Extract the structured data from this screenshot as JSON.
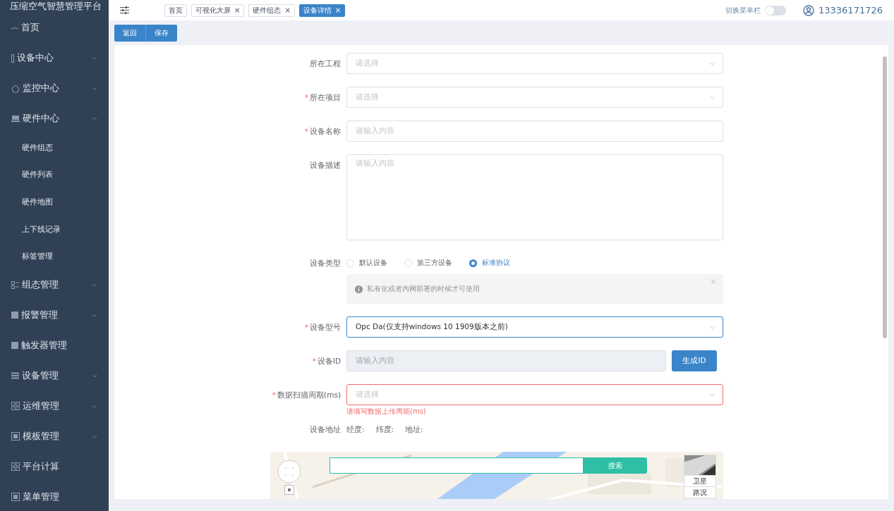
{
  "sidebar": {
    "title": "压缩空气智慧管理平台",
    "items": [
      {
        "label": "首页"
      },
      {
        "label": "设备中心",
        "expanded": false
      },
      {
        "label": "监控中心",
        "expanded": false
      },
      {
        "label": "硬件中心",
        "expanded": true,
        "children": [
          {
            "label": "硬件组态"
          },
          {
            "label": "硬件列表"
          },
          {
            "label": "硬件地图"
          },
          {
            "label": "上下线记录"
          },
          {
            "label": "标签管理"
          }
        ]
      },
      {
        "label": "组态管理",
        "expanded": false
      },
      {
        "label": "报警管理",
        "expanded": false
      },
      {
        "label": "触发器管理"
      },
      {
        "label": "设备管理",
        "expanded": false
      },
      {
        "label": "运维管理",
        "expanded": false
      },
      {
        "label": "模板管理",
        "expanded": false
      },
      {
        "label": "平台计算"
      },
      {
        "label": "菜单管理"
      }
    ]
  },
  "tabs": [
    {
      "label": "首页",
      "selected": false
    },
    {
      "label": "可视化大屏",
      "close": "×",
      "selected": false
    },
    {
      "label": "硬件组态",
      "close": "×",
      "selected": false
    },
    {
      "label": "设备详情",
      "close": "×",
      "selected": true
    }
  ],
  "menu_toggle": {
    "label": "切换菜单栏",
    "on": false
  },
  "user": "13336171726",
  "buttons": [
    "返回",
    "保存"
  ],
  "form": [
    {
      "kind": "select",
      "label": "所在工程",
      "placeholder": "请选择"
    },
    {
      "kind": "select",
      "label": "所在项目",
      "mark": "*",
      "placeholder": "请选择"
    },
    {
      "kind": "input",
      "label": "设备名称",
      "mark": "*",
      "placeholder": "请输入内容"
    },
    {
      "kind": "textarea",
      "label": "设备描述",
      "placeholder": "请输入内容"
    },
    {
      "kind": "radio",
      "label": "设备类型",
      "options": [
        {
          "label": "默认设备",
          "selected": false
        },
        {
          "label": "第三方设备",
          "selected": false
        },
        {
          "label": "标准协议",
          "selected": true
        }
      ]
    },
    {
      "kind": "alert",
      "text": "私有化或者内网部署的时候才可使用",
      "close": "×"
    },
    {
      "kind": "select",
      "label": "设备型号",
      "mark": "*",
      "value": "Opc Da(仅支持windows 10  1909版本之前)",
      "focused": true
    },
    {
      "kind": "generate",
      "label": "设备ID",
      "mark": "*",
      "placeholder": "请输入内容",
      "disabled": true,
      "button": "生成ID"
    },
    {
      "kind": "select",
      "label": "数据扫描周期(ms)",
      "mark": "*",
      "placeholder": "请选择",
      "error": "请填写数据上传周期(ms)"
    },
    {
      "kind": "address",
      "label": "设备地址",
      "parts": [
        "经度:",
        "纬度:",
        "地址:"
      ]
    }
  ],
  "map": {
    "search_button": "搜索",
    "layers": [
      "卫星",
      "路况"
    ]
  }
}
